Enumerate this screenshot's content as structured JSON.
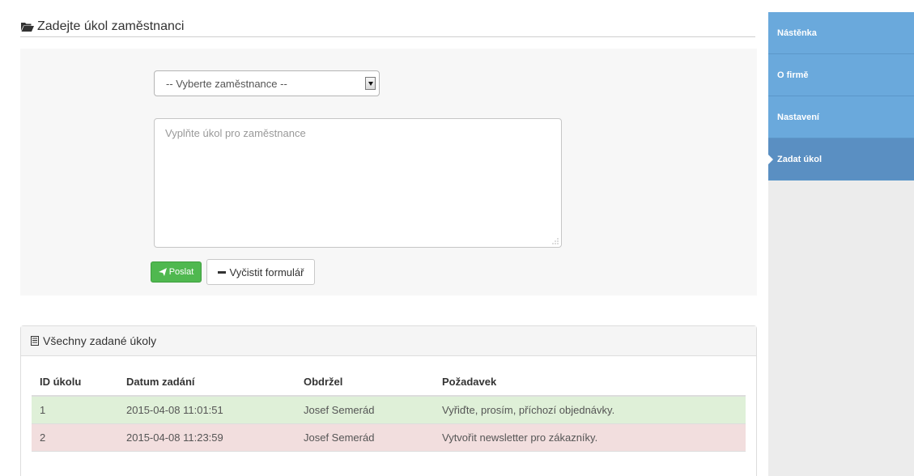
{
  "header": {
    "title": "Zadejte úkol zaměstnanci",
    "icon": "folder-open-icon"
  },
  "form": {
    "employee_select": {
      "value": "-- Vyberte zaměstnance --"
    },
    "task_textarea": {
      "placeholder": "Vyplňte úkol pro zaměstnance"
    },
    "send_button": {
      "label": "Poslat"
    },
    "clear_button": {
      "label": "Vyčistit formulář"
    }
  },
  "tasks_panel": {
    "title": "Všechny zadané úkoly",
    "columns": [
      "ID úkolu",
      "Datum zadání",
      "Obdržel",
      "Požadavek"
    ],
    "rows": [
      {
        "id": "1",
        "date": "2015-04-08 11:01:51",
        "recipient": "Josef Semerád",
        "request": "Vyřiďte, prosím, příchozí objednávky.",
        "status": "success"
      },
      {
        "id": "2",
        "date": "2015-04-08 11:23:59",
        "recipient": "Josef Semerád",
        "request": "Vytvořit newsletter pro zákazníky.",
        "status": "danger"
      }
    ]
  },
  "sidebar": {
    "items": [
      {
        "label": "Nástěnka"
      },
      {
        "label": "O firmě"
      },
      {
        "label": "Nastavení"
      },
      {
        "label": "Zadat úkol",
        "active": true
      }
    ]
  },
  "colors": {
    "accent": "#6aa9dc",
    "active": "#5a8fc2",
    "success": "#dff0d8",
    "danger": "#f2dede",
    "send": "#4fb84f"
  }
}
